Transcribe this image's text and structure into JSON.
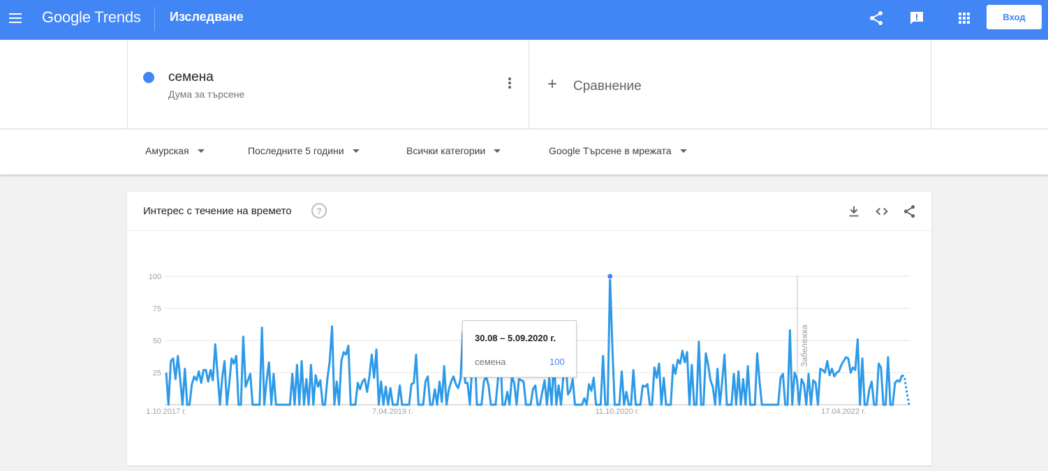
{
  "header": {
    "logo_google": "Google",
    "logo_trends": "Trends",
    "page_name": "Изследване",
    "login_label": "Вход"
  },
  "term": {
    "name": "семена",
    "type": "Дума за търсене",
    "color": "#4285f4"
  },
  "compare": {
    "plus": "+",
    "label": "Сравнение"
  },
  "filters": {
    "region": "Амурская",
    "period": "Последните 5 години",
    "category": "Всички категории",
    "search_type": "Google Търсене в мрежата"
  },
  "card": {
    "title": "Интерес с течение на времето",
    "help": "?"
  },
  "tooltip": {
    "date": "30.08 – 5.09.2020 г.",
    "term": "семена",
    "value": "100"
  },
  "chart_data": {
    "type": "line",
    "ylim": [
      0,
      100
    ],
    "yticks": [
      100,
      75,
      50,
      25
    ],
    "xtick_labels": [
      "1.10.2017 г.",
      "7.04.2019 г.",
      "11.10.2020 г.",
      "17.04.2022 г."
    ],
    "annotation": "Забележка",
    "series": [
      {
        "name": "семена",
        "color": "#2d9ae8",
        "values": [
          25,
          0,
          34,
          36,
          20,
          38,
          20,
          0,
          28,
          0,
          0,
          16,
          22,
          19,
          26,
          17,
          27,
          27,
          18,
          27,
          19,
          47,
          24,
          0,
          21,
          34,
          0,
          16,
          36,
          32,
          38,
          0,
          0,
          53,
          14,
          19,
          24,
          0,
          0,
          0,
          0,
          60,
          0,
          19,
          33,
          0,
          24,
          0,
          0,
          0,
          0,
          0,
          0,
          0,
          24,
          0,
          31,
          0,
          34,
          0,
          20,
          0,
          31,
          0,
          23,
          14,
          19,
          0,
          0,
          20,
          34,
          61,
          0,
          18,
          0,
          34,
          41,
          39,
          46,
          0,
          0,
          0,
          17,
          12,
          18,
          20,
          10,
          22,
          39,
          21,
          43,
          0,
          18,
          0,
          14,
          0,
          13,
          0,
          0,
          0,
          15,
          0,
          0,
          0,
          0,
          16,
          17,
          39,
          0,
          0,
          0,
          18,
          22,
          0,
          0,
          12,
          0,
          18,
          2,
          30,
          0,
          12,
          18,
          22,
          16,
          13,
          20,
          57,
          17,
          17,
          0,
          30,
          45,
          0,
          0,
          0,
          18,
          22,
          15,
          0,
          0,
          0,
          19,
          40,
          0,
          0,
          10,
          0,
          22,
          17,
          0,
          20,
          19,
          18,
          0,
          0,
          0,
          12,
          15,
          0,
          0,
          10,
          19,
          0,
          21,
          0,
          35,
          0,
          15,
          0,
          22,
          33,
          8,
          11,
          20,
          0,
          0,
          0,
          0,
          5,
          0,
          16,
          11,
          21,
          0,
          0,
          0,
          38,
          0,
          0,
          100,
          44,
          0,
          0,
          0,
          26,
          0,
          10,
          0,
          0,
          27,
          0,
          0,
          0,
          15,
          14,
          16,
          0,
          0,
          29,
          21,
          32,
          0,
          21,
          0,
          0,
          0,
          31,
          24,
          35,
          32,
          42,
          33,
          41,
          0,
          31,
          0,
          0,
          49,
          0,
          0,
          40,
          31,
          19,
          14,
          0,
          28,
          0,
          18,
          39,
          0,
          0,
          0,
          24,
          0,
          26,
          0,
          20,
          0,
          30,
          0,
          0,
          0,
          40,
          18,
          0,
          0,
          0,
          0,
          0,
          0,
          0,
          0,
          21,
          24,
          0,
          0,
          58,
          0,
          25,
          20,
          0,
          20,
          16,
          0,
          24,
          0,
          19,
          17,
          0,
          28,
          27,
          25,
          34,
          23,
          28,
          22,
          25,
          26,
          31,
          34,
          37,
          36,
          25,
          29,
          27,
          51,
          0,
          36,
          0,
          0,
          12,
          18,
          0,
          0,
          32,
          29,
          0,
          0,
          37,
          0,
          0,
          17,
          19,
          18,
          23,
          22,
          10,
          0
        ],
        "partial_last_points": 3
      }
    ]
  }
}
